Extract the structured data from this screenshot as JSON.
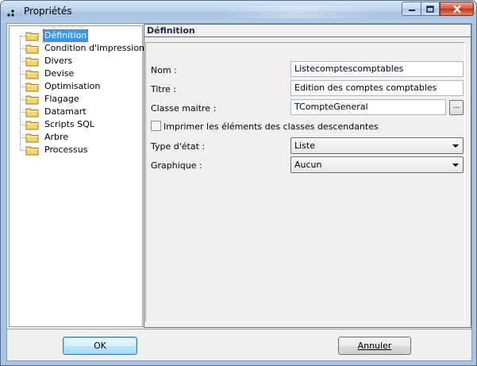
{
  "window": {
    "title": "Propriétés"
  },
  "tree": {
    "items": [
      {
        "label": "Définition",
        "selected": true
      },
      {
        "label": "Condition d'impression",
        "selected": false
      },
      {
        "label": "Divers",
        "selected": false
      },
      {
        "label": "Devise",
        "selected": false
      },
      {
        "label": "Optimisation",
        "selected": false
      },
      {
        "label": "Flagage",
        "selected": false
      },
      {
        "label": "Datamart",
        "selected": false
      },
      {
        "label": "Scripts SQL",
        "selected": false
      },
      {
        "label": "Arbre",
        "selected": false
      },
      {
        "label": "Processus",
        "selected": false
      }
    ]
  },
  "panel": {
    "title": "Définition",
    "nom_label": "Nom :",
    "nom_value": "Listecomptescomptables",
    "titre_label": "Titre :",
    "titre_value": "Edition des comptes comptables",
    "classe_label": "Classe maitre :",
    "classe_value": "TCompteGeneral",
    "browse_label": "...",
    "checkbox_label": "Imprimer les éléments des classes descendantes",
    "checkbox_checked": false,
    "type_label": "Type d'état :",
    "type_value": "Liste",
    "graph_label": "Graphique :",
    "graph_value": "Aucun"
  },
  "buttons": {
    "ok": "OK",
    "cancel": "Annuler"
  },
  "colors": {
    "selection": "#3399ff",
    "title_bar": "#b9d0ea",
    "close_button": "#c13718"
  }
}
